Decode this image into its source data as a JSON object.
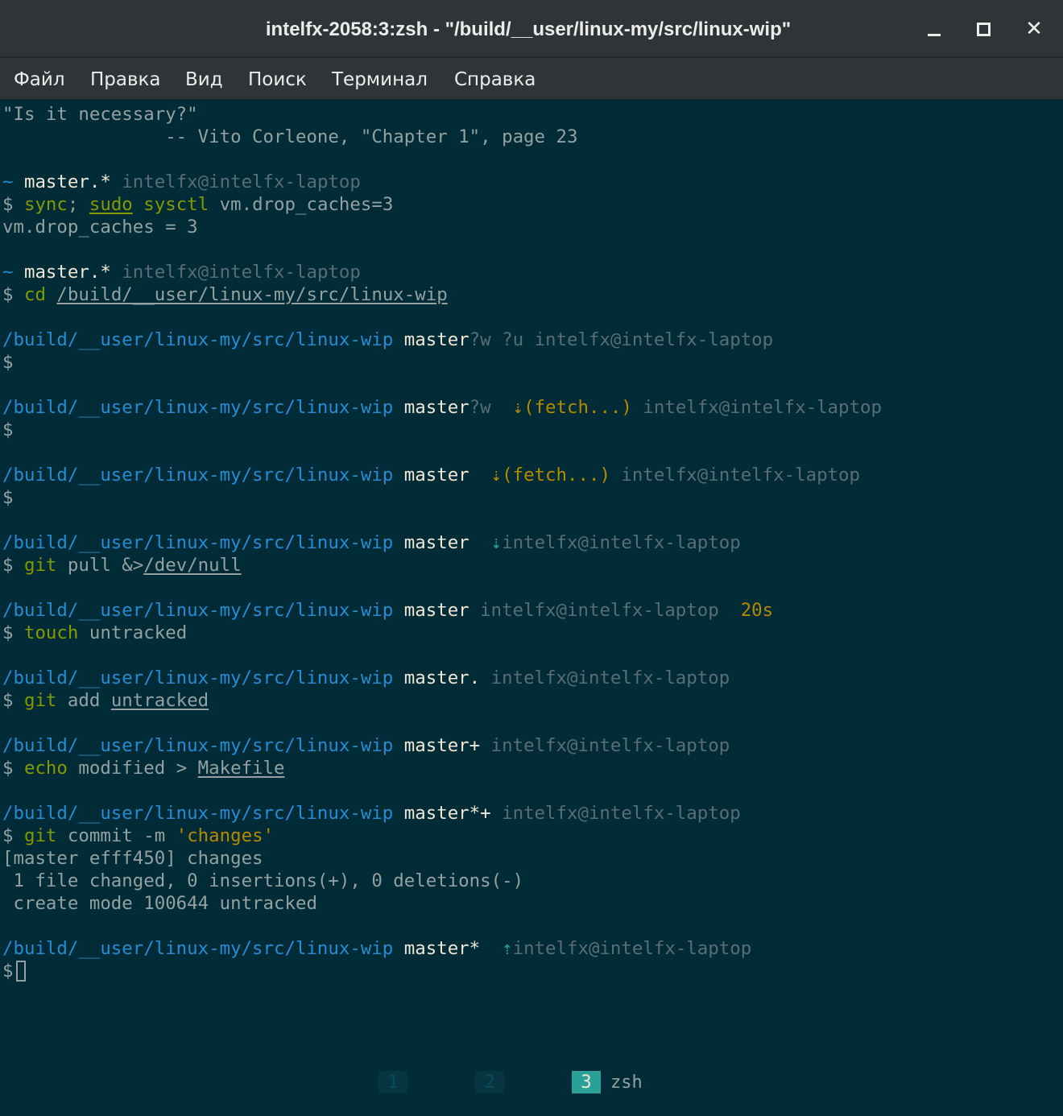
{
  "window": {
    "title": "intelfx-2058:3:zsh - \"/build/__user/linux-my/src/linux-wip\"",
    "buttons": {
      "minimize": "minimize",
      "maximize": "maximize",
      "close": "close"
    }
  },
  "menu": {
    "items": [
      "Файл",
      "Правка",
      "Вид",
      "Поиск",
      "Терминал",
      "Справка"
    ]
  },
  "terminal": {
    "path": "/build/__user/linux-my/src/linux-wip",
    "user": "intelfx@intelfx-laptop",
    "prompt_symbol": "$",
    "home": "~",
    "quote": "\"Is it necessary?\"",
    "attribution": "               -- Vito Corleone, \"Chapter 1\", page 23",
    "cmd1": {
      "a": "sync",
      "b": "; ",
      "c": "sudo",
      "d": " ",
      "e": "sysctl",
      "f": " vm.drop_caches=3"
    },
    "out1": "vm.drop_caches = 3",
    "cmd2": {
      "a": "cd",
      "b": " ",
      "c": "/build/__user/linux-my/src/linux-wip"
    },
    "branch_a": "master.*",
    "b3": {
      "branch": "master",
      "flags": "?w ?u"
    },
    "b4": {
      "branch": "master",
      "flags": "?w",
      "fetch": "⇣(fetch...)"
    },
    "b5": {
      "branch": "master",
      "fetch": "⇣(fetch...)"
    },
    "b6": {
      "branch": "master",
      "arrow": "⇣"
    },
    "cmd6": {
      "a": "git",
      "b": " pull &>",
      "c": "/dev/null"
    },
    "b7": {
      "branch": "master",
      "time": "20s"
    },
    "cmd7": {
      "a": "touch",
      "b": " untracked"
    },
    "b8": {
      "branch": "master."
    },
    "cmd8": {
      "a": "git",
      "b": " add ",
      "c": "untracked"
    },
    "b9": {
      "branch": "master+"
    },
    "cmd9": {
      "a": "echo",
      "b": " modified > ",
      "c": "Makefile"
    },
    "b10": {
      "branch": "master*+"
    },
    "cmd10": {
      "a": "git",
      "b": " commit -m ",
      "c": "'changes'"
    },
    "out10": [
      "[master efff450] changes",
      " 1 file changed, 0 insertions(+), 0 deletions(-)",
      " create mode 100644 untracked"
    ],
    "b11": {
      "branch": "master*",
      "arrow": "⇡"
    }
  },
  "tabs": [
    {
      "num": "1",
      "name": ""
    },
    {
      "num": "2",
      "name": ""
    },
    {
      "num": "3",
      "name": "zsh"
    }
  ],
  "colors": {
    "background": "#012b36",
    "path": "#268bd2",
    "branch": "#eee8d5",
    "dim": "#586e75",
    "command": "#859900",
    "yellow": "#b58900",
    "active_tab": "#2aa198"
  }
}
